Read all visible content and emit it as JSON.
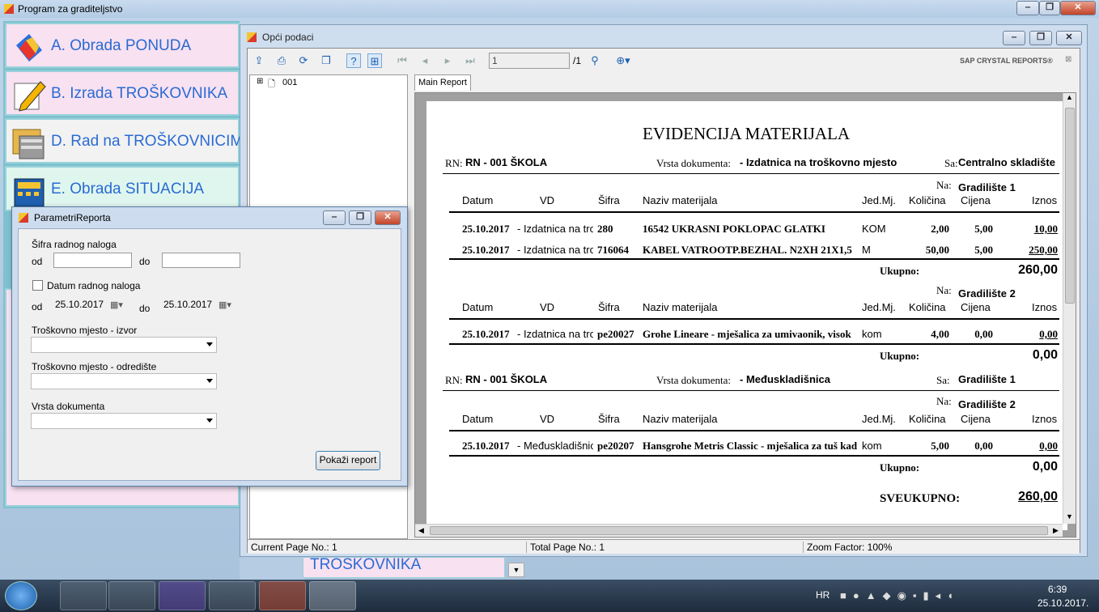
{
  "main_window": {
    "title": "Program za graditeljstvo"
  },
  "menu": {
    "items": [
      {
        "label": "A. Obrada PONUDA",
        "icon": "tag-icon",
        "bg": "#f8e1f0"
      },
      {
        "label": "B. Izrada TROŠKOVNIKA",
        "icon": "pencil-icon",
        "bg": "#f8e1f0"
      },
      {
        "label": "D. Rad na TROŠKOVNICIMA",
        "icon": "folders-icon",
        "bg": "#f2f2f2"
      },
      {
        "label": "E. Obrada SITUACIJA",
        "icon": "calculator-icon",
        "bg": "#def6ee"
      }
    ],
    "bottom_partial": "TROŠKOVNIKA"
  },
  "opci": {
    "title": "Opći podaci",
    "page_input": "1",
    "page_total": "/1",
    "brand": "SAP CRYSTAL REPORTS®",
    "tree_node": "001",
    "tab": "Main Report",
    "status": {
      "current": "Current Page No.: 1",
      "total": "Total Page No.: 1",
      "zoom": "Zoom Factor: 100%"
    }
  },
  "report": {
    "title": "EVIDENCIJA MATERIJALA",
    "cols": {
      "datum": "Datum",
      "vd": "VD",
      "sifra": "Šifra",
      "naziv": "Naziv materijala",
      "jed": "Jed.Mj.",
      "kol": "Količina",
      "cijena": "Cijena",
      "iznos": "Iznos"
    },
    "lbl_rn": "RN:",
    "lbl_vrsta": "Vrsta dokumenta:",
    "lbl_sa": "Sa:",
    "lbl_na": "Na:",
    "lbl_ukupno": "Ukupno:",
    "lbl_sveukupno": "SVEUKUPNO:",
    "groups": [
      {
        "rn": "RN - 001 ŠKOLA",
        "vrsta": "- Izdatnica na troškovno mjesto",
        "sa": "Centralno skladište",
        "na": "Gradilište 1",
        "rows": [
          {
            "datum": "25.10.2017",
            "vd": "- Izdatnica na tro",
            "sifra": "280",
            "naziv": "16542 UKRASNI POKLOPAC GLATKI",
            "jed": "KOM",
            "kol": "2,00",
            "cijena": "5,00",
            "iznos": "10,00"
          },
          {
            "datum": "25.10.2017",
            "vd": "- Izdatnica na tro",
            "sifra": "716064",
            "naziv": "KABEL VATROOTP.BEZHAL. N2XH 21X1,5",
            "jed": "M",
            "kol": "50,00",
            "cijena": "5,00",
            "iznos": "250,00"
          }
        ],
        "ukupno": "260,00"
      },
      {
        "na": "Gradilište 2",
        "rows": [
          {
            "datum": "25.10.2017",
            "vd": "- Izdatnica na tro",
            "sifra": "pe20027",
            "naziv": "Grohe Lineare - mješalica za umivaonik, visok",
            "jed": "kom",
            "kol": "4,00",
            "cijena": "0,00",
            "iznos": "0,00"
          }
        ],
        "ukupno": "0,00"
      },
      {
        "rn": "RN - 001 ŠKOLA",
        "vrsta": "- Međuskladišnica",
        "sa": "Gradilište 1",
        "na": "Gradilište 2",
        "rows": [
          {
            "datum": "25.10.2017",
            "vd": "- Međuskladišnic",
            "sifra": "pe20207",
            "naziv": "Hansgrohe Metris Classic - mješalica za tuš kad",
            "jed": "kom",
            "kol": "5,00",
            "cijena": "0,00",
            "iznos": "0,00"
          }
        ],
        "ukupno": "0,00"
      }
    ],
    "sveukupno": "260,00"
  },
  "param": {
    "title": "ParametriReporta",
    "sifra_label": "Šifra radnog naloga",
    "od": "od",
    "do": "do",
    "sifra_od_value": "",
    "sifra_do_value": "",
    "datum_label": "Datum radnog naloga",
    "date_from": "25.10.2017",
    "date_to": "25.10.2017",
    "izvor_label": "Troškovno mjesto - izvor",
    "odrediste_label": "Troškovno mjesto - odredište",
    "vrsta_label": "Vrsta dokumenta",
    "button": "Pokaži report"
  },
  "taskbar": {
    "lang": "HR",
    "time": "6:39",
    "date": "25.10.2017."
  }
}
